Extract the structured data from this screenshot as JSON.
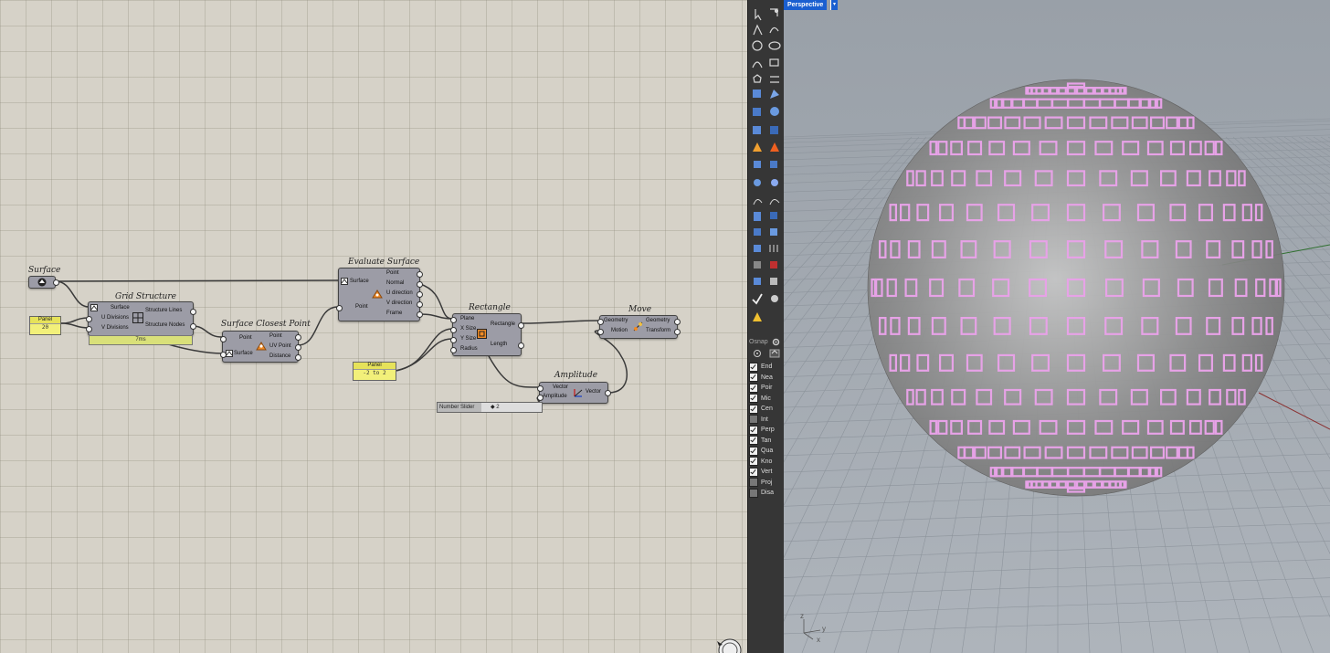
{
  "canvas": {
    "components": {
      "surface": {
        "title": "Surface"
      },
      "grid_structure": {
        "title": "Grid Structure",
        "inputs": [
          "Surface",
          "U Divisions",
          "V Divisions"
        ],
        "outputs": [
          "Structure Lines",
          "Structure Nodes"
        ],
        "timer": "7ms"
      },
      "surface_closest_point": {
        "title": "Surface Closest Point",
        "inputs": [
          "Point",
          "Surface"
        ],
        "outputs": [
          "Point",
          "UV Point",
          "Distance"
        ]
      },
      "evaluate_surface": {
        "title": "Evaluate Surface",
        "inputs": [
          "Surface",
          "Point"
        ],
        "outputs": [
          "Point",
          "Normal",
          "U direction",
          "V direction",
          "Frame"
        ]
      },
      "rectangle": {
        "title": "Rectangle",
        "inputs": [
          "Plane",
          "X Size",
          "Y Size",
          "Radius"
        ],
        "outputs": [
          "Rectangle",
          "Length"
        ]
      },
      "move": {
        "title": "Move",
        "inputs": [
          "Geometry",
          "Motion"
        ],
        "outputs": [
          "Geometry",
          "Transform"
        ]
      },
      "amplitude": {
        "title": "Amplitude",
        "inputs": [
          "Vector",
          "Amplitude"
        ],
        "outputs": [
          "Vector"
        ]
      }
    },
    "panel1": {
      "header": "Panel",
      "value": "20"
    },
    "panel2": {
      "header": "Panel",
      "value": "-2 to 2"
    },
    "slider": {
      "label": "Number Slider",
      "value": "◆ 2"
    }
  },
  "osnap": {
    "title": "Osnap",
    "items": [
      {
        "label": "End",
        "checked": true
      },
      {
        "label": "Nea",
        "checked": true
      },
      {
        "label": "Poir",
        "checked": true
      },
      {
        "label": "Mic",
        "checked": true
      },
      {
        "label": "Cen",
        "checked": true
      },
      {
        "label": "Int",
        "checked": false
      },
      {
        "label": "Perp",
        "checked": true
      },
      {
        "label": "Tan",
        "checked": true
      },
      {
        "label": "Qua",
        "checked": true
      },
      {
        "label": "Kno",
        "checked": true
      },
      {
        "label": "Vert",
        "checked": true
      },
      {
        "label": "Proj",
        "checked": false
      },
      {
        "label": "Disa",
        "checked": false
      }
    ]
  },
  "viewport": {
    "label": "Perspective",
    "axis_x": "x",
    "axis_y": "y",
    "axis_z": "z"
  },
  "colors": {
    "canvas_bg": "#d6d2c8",
    "component": "#9c9ca6",
    "panel": "#f2f07a",
    "viewport_bg": "#a3a9b0",
    "rect_curves": "#e8a0e8",
    "active_view": "#1a5fd0"
  }
}
